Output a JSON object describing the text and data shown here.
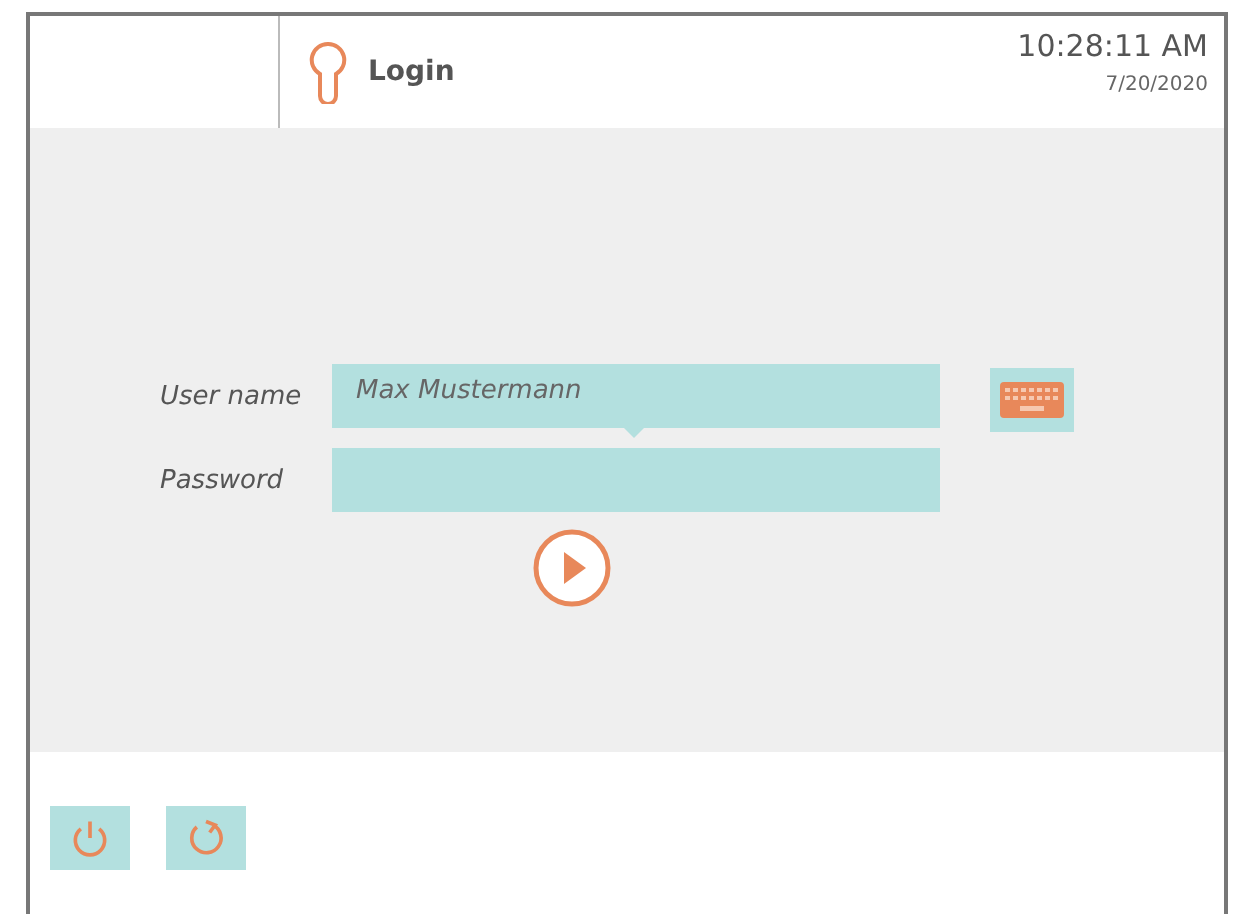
{
  "header": {
    "title": "Login",
    "time": "10:28:11 AM",
    "date": "7/20/2020"
  },
  "form": {
    "fields": [
      {
        "label": "User name",
        "value": "Max Mustermann",
        "focused": true
      },
      {
        "label": "Password",
        "focused": false
      }
    ]
  }
}
